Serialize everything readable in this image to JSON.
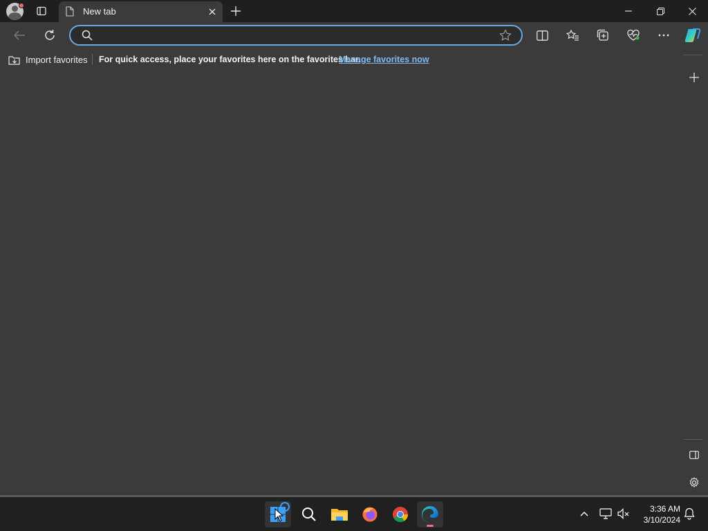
{
  "tab": {
    "title": "New tab"
  },
  "address": {
    "value": "",
    "placeholder": ""
  },
  "favorites_bar": {
    "import_label": "Import favorites",
    "message": "For quick access, place your favorites here on the favorites bar.",
    "manage_link": "Manage favorites now"
  },
  "clock": {
    "time": "3:36 AM",
    "date": "3/10/2024"
  },
  "colors": {
    "address_focus_border": "#6aa8df",
    "link": "#7fb9f0",
    "content_background": "#3b3b3b",
    "taskbar_background": "#202020"
  },
  "icons": {
    "titlebar": [
      "profile-icon",
      "tab-actions-icon",
      "page-icon",
      "close-tab-icon",
      "new-tab-icon",
      "minimize-icon",
      "restore-icon",
      "close-window-icon"
    ],
    "toolbar": [
      "back-icon",
      "refresh-icon",
      "search-icon",
      "favorite-star-icon",
      "split-screen-icon",
      "favorites-icon",
      "collections-icon",
      "browser-essentials-icon",
      "more-icon",
      "copilot-icon"
    ],
    "sidebar": [
      "add-sidebar-icon",
      "hide-sidebar-icon",
      "settings-icon"
    ],
    "taskbar": [
      "start-icon",
      "search-icon",
      "file-explorer-icon",
      "firefox-icon",
      "chrome-icon",
      "edge-icon"
    ],
    "tray": [
      "show-hidden-icons-icon",
      "network-icon",
      "volume-muted-icon",
      "notifications-icon"
    ]
  }
}
